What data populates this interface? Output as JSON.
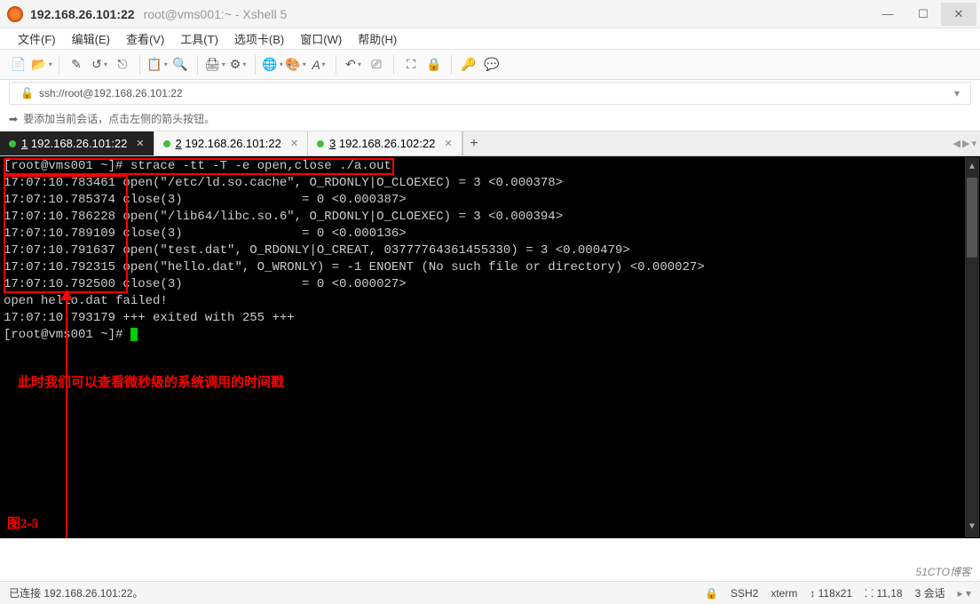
{
  "window": {
    "title_strong": "192.168.26.101:22",
    "title_light": "root@vms001:~ - Xshell 5"
  },
  "menus": {
    "file": "文件(F)",
    "edit": "编辑(E)",
    "view": "查看(V)",
    "tools": "工具(T)",
    "tabs": "选项卡(B)",
    "window": "窗口(W)",
    "help": "帮助(H)"
  },
  "address": {
    "url": "ssh://root@192.168.26.101:22"
  },
  "hint": {
    "text": "要添加当前会话，点击左侧的箭头按钮。"
  },
  "tabs": [
    {
      "idx": "1",
      "label": "192.168.26.101:22",
      "active": true
    },
    {
      "idx": "2",
      "label": "192.168.26.101:22",
      "active": false
    },
    {
      "idx": "3",
      "label": "192.168.26.102:22",
      "active": false
    }
  ],
  "terminal": {
    "prompt1": "[root@vms001 ~]# ",
    "cmd": "strace -tt -T -e open,close ./a.out",
    "lines": [
      "17:07:10.783461 open(\"/etc/ld.so.cache\", O_RDONLY|O_CLOEXEC) = 3 <0.000378>",
      "17:07:10.785374 close(3)                = 0 <0.000387>",
      "17:07:10.786228 open(\"/lib64/libc.so.6\", O_RDONLY|O_CLOEXEC) = 3 <0.000394>",
      "17:07:10.789109 close(3)                = 0 <0.000136>",
      "17:07:10.791637 open(\"test.dat\", O_RDONLY|O_CREAT, 03777764361455330) = 3 <0.000479>",
      "17:07:10.792315 open(\"hello.dat\", O_WRONLY) = -1 ENOENT (No such file or directory) <0.000027>",
      "17:07:10.792500 close(3)                = 0 <0.000027>",
      "open hello.dat failed!",
      "17:07:10.793179 +++ exited with 255 +++"
    ],
    "prompt2": "[root@vms001 ~]# ",
    "annotation": "此时我们可以查看微秒级的系统调用的时间戳",
    "figure_label": "图2-5"
  },
  "status": {
    "conn": "已连接 192.168.26.101:22。",
    "proto": "SSH2",
    "termtype": "xterm",
    "size": "118x21",
    "pos": "11,18",
    "sessions": "3 会话"
  },
  "watermark": "51CTO博客",
  "toolbar_tips": {
    "new": "new",
    "open": "open",
    "edit": "edit",
    "reconnect": "reconnect",
    "disconnect": "disconnect",
    "copy": "copy",
    "paste": "paste",
    "find": "find",
    "print": "print",
    "props": "properties",
    "globe": "web",
    "color": "color",
    "font": "font",
    "zoom": "zoom",
    "clear": "clear",
    "full": "fullscreen",
    "lock": "lock",
    "keys": "keys",
    "chat": "chat"
  }
}
